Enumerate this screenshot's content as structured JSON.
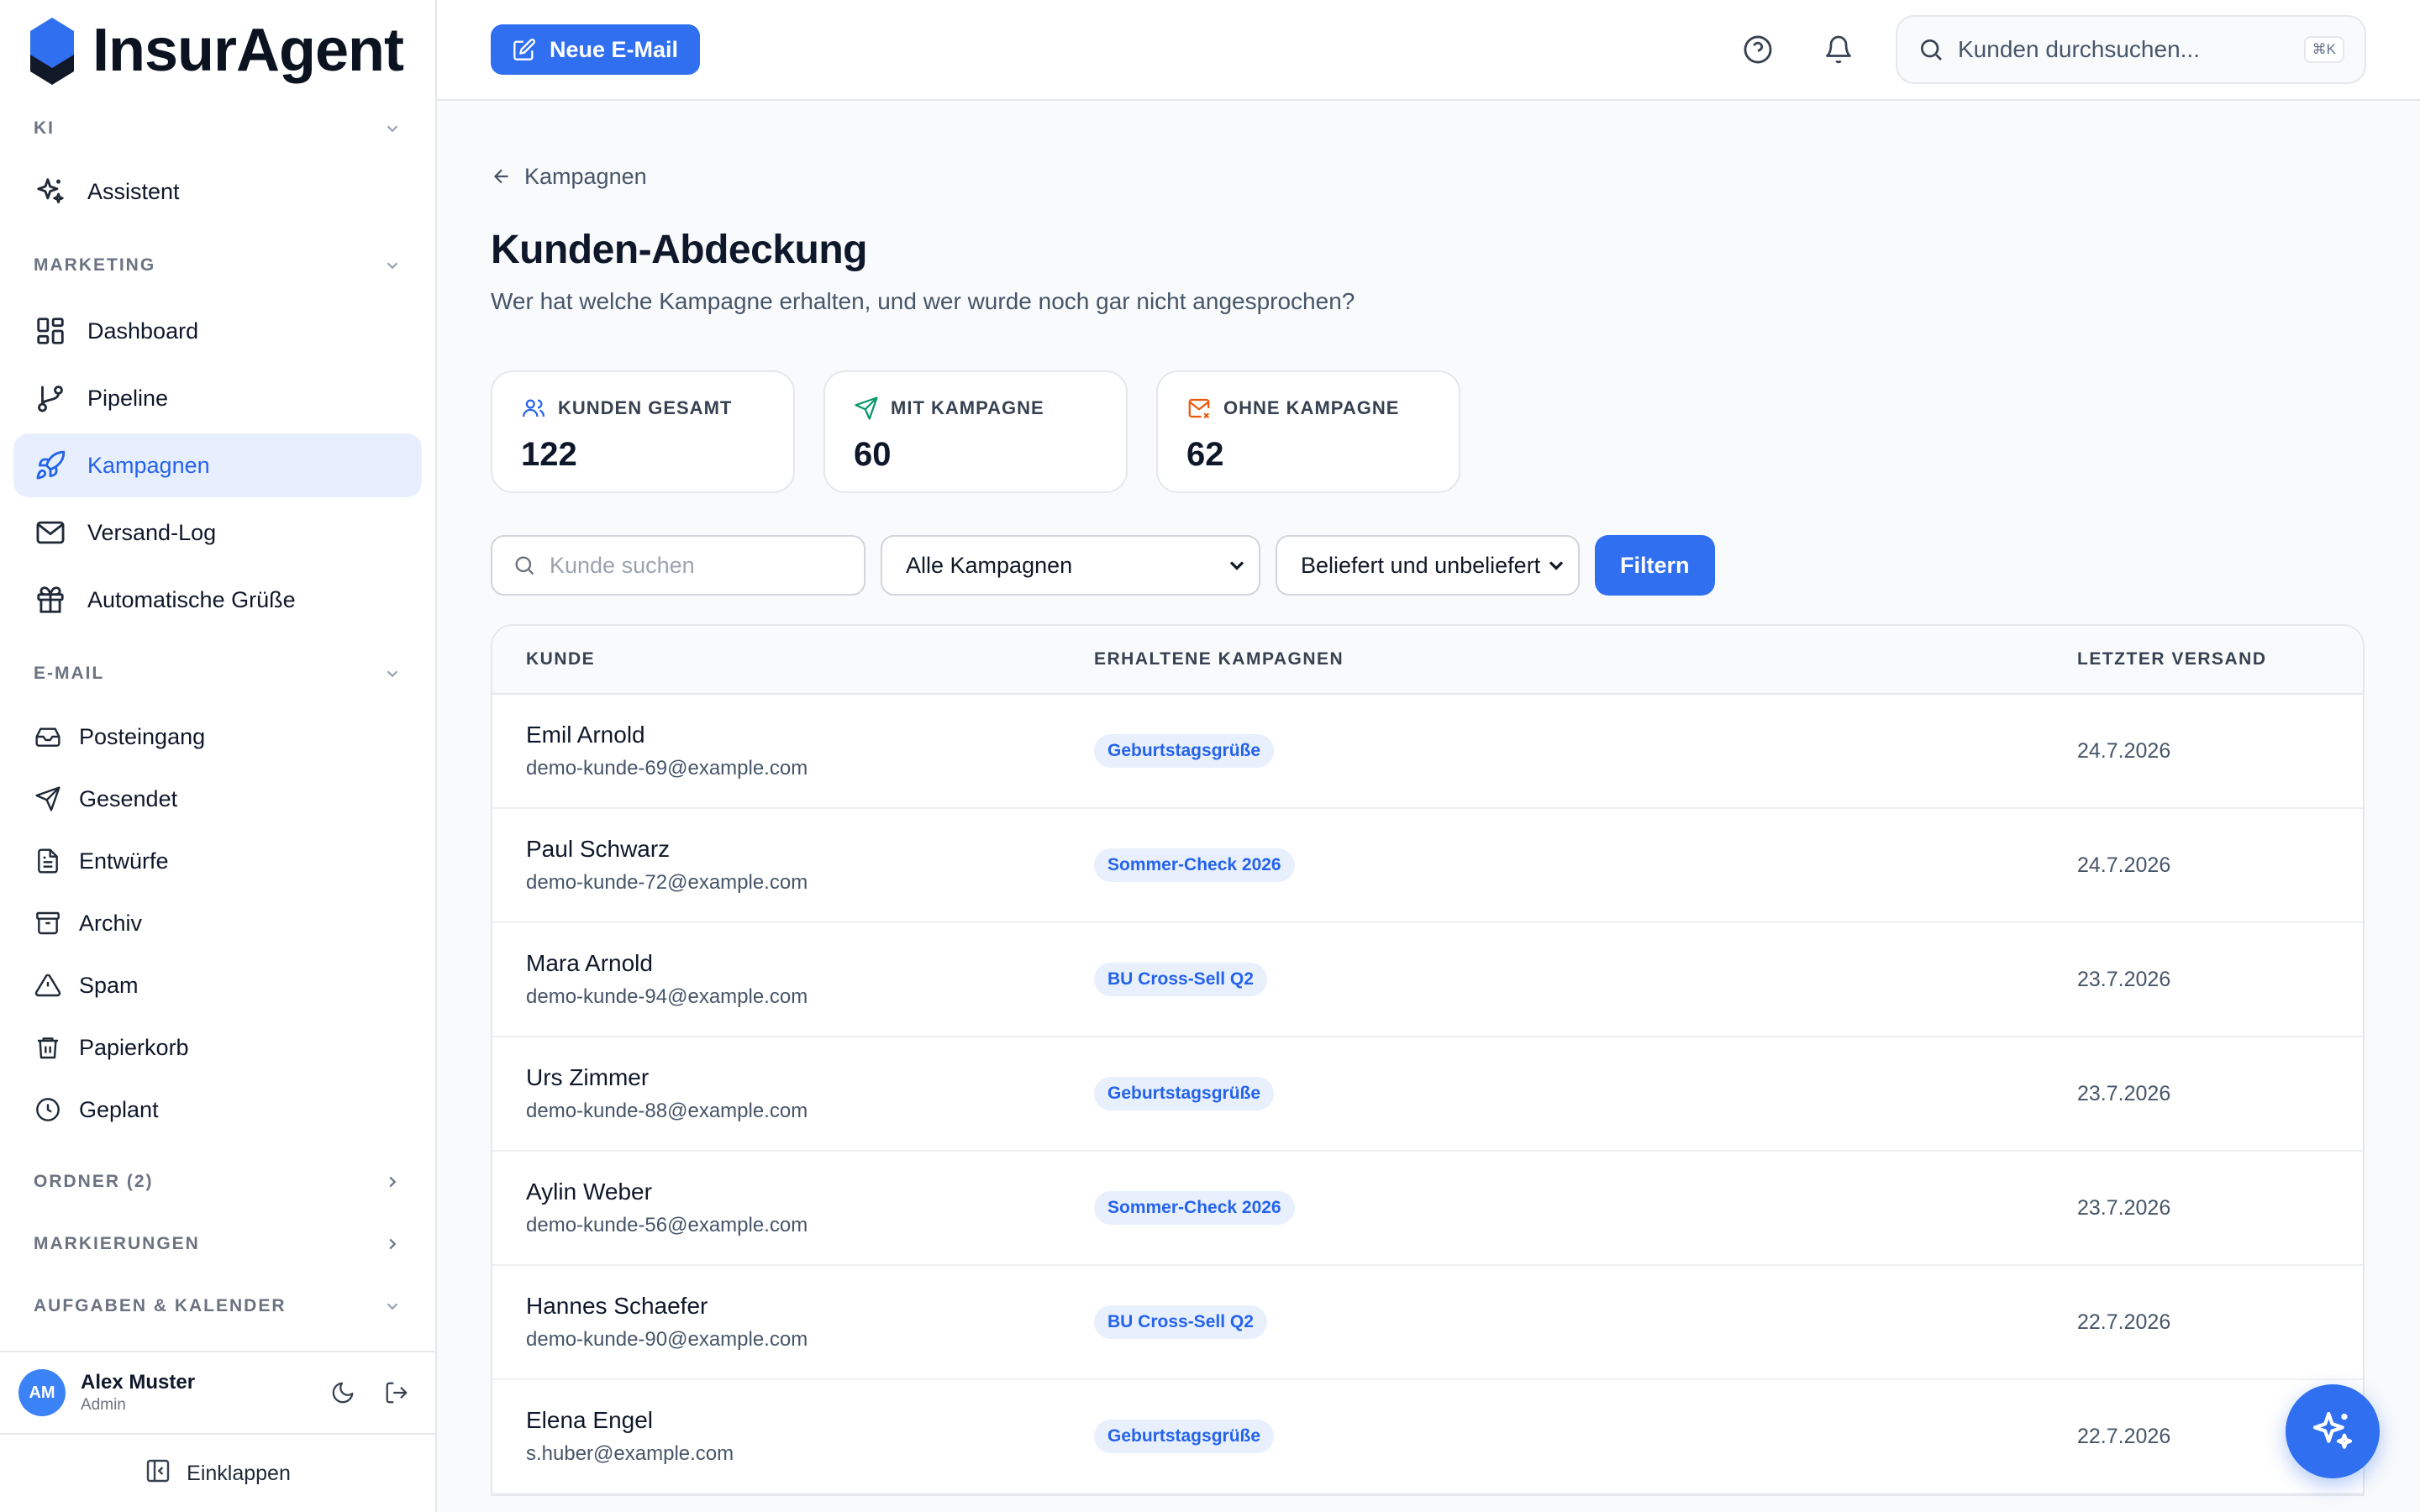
{
  "app": {
    "name": "InsurAgent",
    "brand_color": "#2f6ff0"
  },
  "sidebar": {
    "sections": [
      {
        "title": "KI",
        "items": [
          {
            "label": "Assistent",
            "icon": "sparkles-icon"
          }
        ]
      },
      {
        "title": "MARKETING",
        "items": [
          {
            "label": "Dashboard",
            "icon": "dashboard-icon"
          },
          {
            "label": "Pipeline",
            "icon": "git-branch-icon"
          },
          {
            "label": "Kampagnen",
            "icon": "rocket-icon",
            "active": true
          },
          {
            "label": "Versand-Log",
            "icon": "mail-icon"
          },
          {
            "label": "Automatische Grüße",
            "icon": "gift-icon"
          }
        ]
      },
      {
        "title": "E-MAIL",
        "items": [
          {
            "label": "Posteingang",
            "icon": "inbox-icon"
          },
          {
            "label": "Gesendet",
            "icon": "send-icon"
          },
          {
            "label": "Entwürfe",
            "icon": "file-icon"
          },
          {
            "label": "Archiv",
            "icon": "archive-icon"
          },
          {
            "label": "Spam",
            "icon": "warning-icon"
          },
          {
            "label": "Papierkorb",
            "icon": "trash-icon"
          },
          {
            "label": "Geplant",
            "icon": "clock-icon"
          }
        ]
      },
      {
        "title": "ORDNER (2)"
      },
      {
        "title": "MARKIERUNGEN"
      },
      {
        "title": "AUFGABEN & KALENDER"
      }
    ],
    "user": {
      "initials": "AM",
      "name": "Alex Muster",
      "role": "Admin"
    },
    "collapse_label": "Einklappen"
  },
  "topbar": {
    "new_email_label": "Neue E-Mail",
    "search_placeholder": "Kunden durchsuchen...",
    "search_shortcut": "⌘K"
  },
  "page": {
    "back_label": "Kampagnen",
    "title": "Kunden-Abdeckung",
    "subtitle": "Wer hat welche Kampagne erhalten, und wer wurde noch gar nicht angesprochen?",
    "stats": [
      {
        "label": "KUNDEN GESAMT",
        "value": "122",
        "icon": "users-icon",
        "color": "#2563eb"
      },
      {
        "label": "MIT KAMPAGNE",
        "value": "60",
        "icon": "send-icon",
        "color": "#059669"
      },
      {
        "label": "OHNE KAMPAGNE",
        "value": "62",
        "icon": "mail-x-icon",
        "color": "#ea580c"
      }
    ],
    "filters": {
      "search_placeholder": "Kunde suchen",
      "campaign_select": "Alle Kampagnen",
      "delivery_select": "Beliefert und unbeliefert",
      "filter_button": "Filtern"
    },
    "table": {
      "columns": [
        "KUNDE",
        "ERHALTENE KAMPAGNEN",
        "LETZTER VERSAND"
      ],
      "rows": [
        {
          "name": "Emil Arnold",
          "email": "demo-kunde-69@example.com",
          "campaign": "Geburtstagsgrüße",
          "date": "24.7.2026"
        },
        {
          "name": "Paul Schwarz",
          "email": "demo-kunde-72@example.com",
          "campaign": "Sommer-Check 2026",
          "date": "24.7.2026"
        },
        {
          "name": "Mara Arnold",
          "email": "demo-kunde-94@example.com",
          "campaign": "BU Cross-Sell Q2",
          "date": "23.7.2026"
        },
        {
          "name": "Urs Zimmer",
          "email": "demo-kunde-88@example.com",
          "campaign": "Geburtstagsgrüße",
          "date": "23.7.2026"
        },
        {
          "name": "Aylin Weber",
          "email": "demo-kunde-56@example.com",
          "campaign": "Sommer-Check 2026",
          "date": "23.7.2026"
        },
        {
          "name": "Hannes Schaefer",
          "email": "demo-kunde-90@example.com",
          "campaign": "BU Cross-Sell Q2",
          "date": "22.7.2026"
        },
        {
          "name": "Elena Engel",
          "email": "s.huber@example.com",
          "campaign": "Geburtstagsgrüße",
          "date": "22.7.2026"
        }
      ]
    }
  }
}
